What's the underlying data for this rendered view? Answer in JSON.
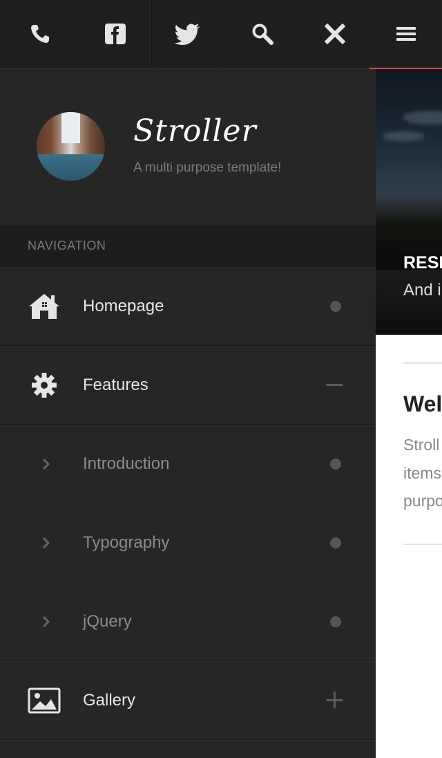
{
  "toolbar": {
    "icons": [
      "phone-icon",
      "facebook-icon",
      "twitter-icon",
      "search-icon",
      "close-icon",
      "menu-icon"
    ],
    "accent_color": "#e2493b"
  },
  "profile": {
    "brand": "Stroller",
    "tagline": "A multi purpose template!"
  },
  "navigation": {
    "heading": "NAVIGATION",
    "items": [
      {
        "label": "Homepage",
        "icon": "home-icon",
        "indicator": "dot"
      },
      {
        "label": "Features",
        "icon": "gear-icon",
        "indicator": "minus"
      },
      {
        "label": "Introduction",
        "icon": "chevron-right-icon",
        "indicator": "dot"
      },
      {
        "label": "Typography",
        "icon": "chevron-right-icon",
        "indicator": "dot"
      },
      {
        "label": "jQuery",
        "icon": "chevron-right-icon",
        "indicator": "dot"
      },
      {
        "label": "Gallery",
        "icon": "image-icon",
        "indicator": "plus"
      }
    ]
  },
  "content": {
    "hero_title": "RESI",
    "hero_subtitle": "And i",
    "heading": "Wel",
    "paragraph_lines": [
      "Stroll",
      "items",
      "purpo"
    ]
  }
}
